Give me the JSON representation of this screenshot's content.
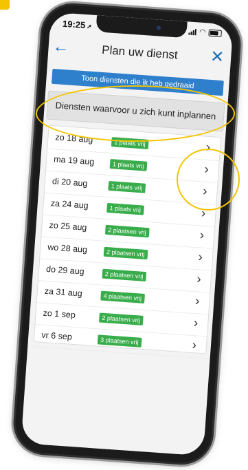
{
  "status": {
    "time": "19:25",
    "location_glyph": "➚"
  },
  "header": {
    "back_icon": "←",
    "title": "Plan uw dienst",
    "close_icon": "✕"
  },
  "filter_button": {
    "label": "Toon diensten die ik heb gedraaid"
  },
  "section": {
    "label": "Diensten waarvoor u zich kunt inplannen"
  },
  "shifts": [
    {
      "date": "zo 18 aug",
      "availability": "1 plaats vrij"
    },
    {
      "date": "ma 19 aug",
      "availability": "1 plaats vrij"
    },
    {
      "date": "di 20 aug",
      "availability": "1 plaats vrij"
    },
    {
      "date": "za 24 aug",
      "availability": "1 plaats vrij"
    },
    {
      "date": "zo 25 aug",
      "availability": "2 plaatsen vrij"
    },
    {
      "date": "wo 28 aug",
      "availability": "2 plaatsen vrij"
    },
    {
      "date": "do 29 aug",
      "availability": "2 plaatsen vrij"
    },
    {
      "date": "za 31 aug",
      "availability": "4 plaatsen vrij"
    },
    {
      "date": "zo 1 sep",
      "availability": "2 plaatsen vrij"
    },
    {
      "date": "vr 6 sep",
      "availability": "3 plaatsen vrij"
    }
  ],
  "chevron_glyph": "›",
  "colors": {
    "accent": "#2e80cc",
    "badge": "#39ad4b",
    "highlight": "#f5c400"
  }
}
